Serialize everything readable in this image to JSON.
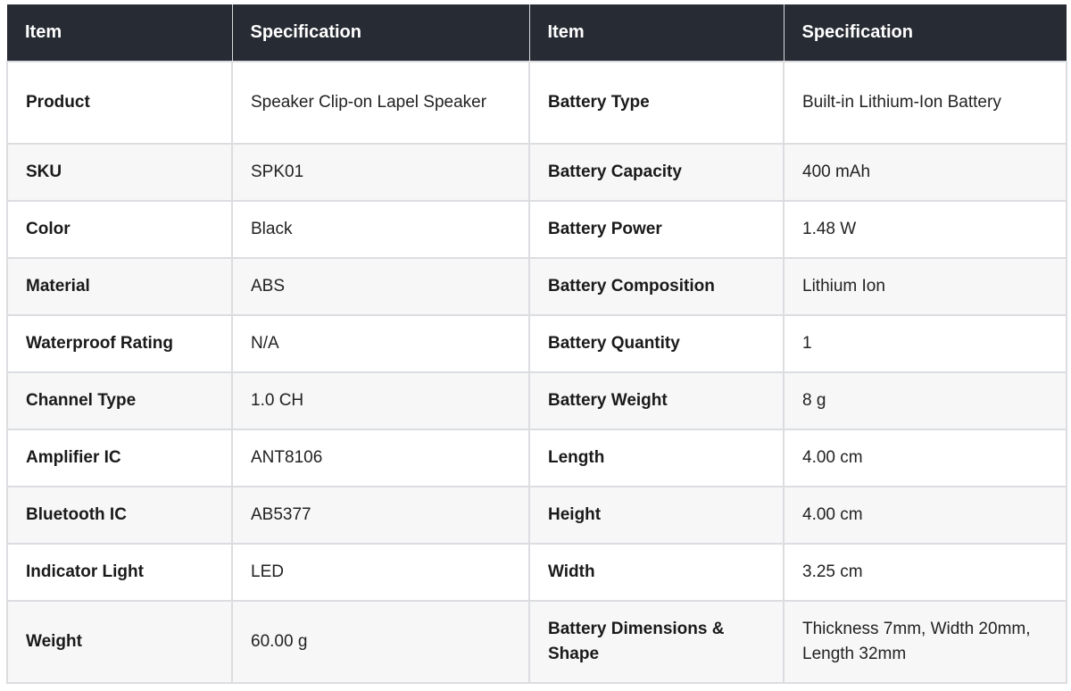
{
  "table": {
    "headers": [
      "Item",
      "Specification",
      "Item",
      "Specification"
    ],
    "rows": [
      [
        "Product",
        "Speaker Clip-on Lapel Speaker",
        "Battery Type",
        "Built-in Lithium-Ion Battery"
      ],
      [
        "SKU",
        "SPK01",
        "Battery Capacity",
        "400 mAh"
      ],
      [
        "Color",
        "Black",
        "Battery Power",
        "1.48 W"
      ],
      [
        "Material",
        "ABS",
        "Battery Composition",
        "Lithium Ion"
      ],
      [
        "Waterproof Rating",
        "N/A",
        "Battery Quantity",
        "1"
      ],
      [
        "Channel Type",
        "1.0 CH",
        "Battery Weight",
        "8 g"
      ],
      [
        "Amplifier IC",
        "ANT8106",
        "Length",
        "4.00 cm"
      ],
      [
        "Bluetooth IC",
        "AB5377",
        "Height",
        "4.00 cm"
      ],
      [
        "Indicator Light",
        "LED",
        "Width",
        "3.25 cm"
      ],
      [
        "Weight",
        "60.00 g",
        "Battery Dimensions & Shape",
        "Thickness 7mm, Width 20mm, Length 32mm"
      ]
    ],
    "colors": {
      "header_bg": "#272b33",
      "header_text": "#ffffff",
      "border": "#dcdde0",
      "row_alt_bg": "#f7f7f8"
    }
  }
}
